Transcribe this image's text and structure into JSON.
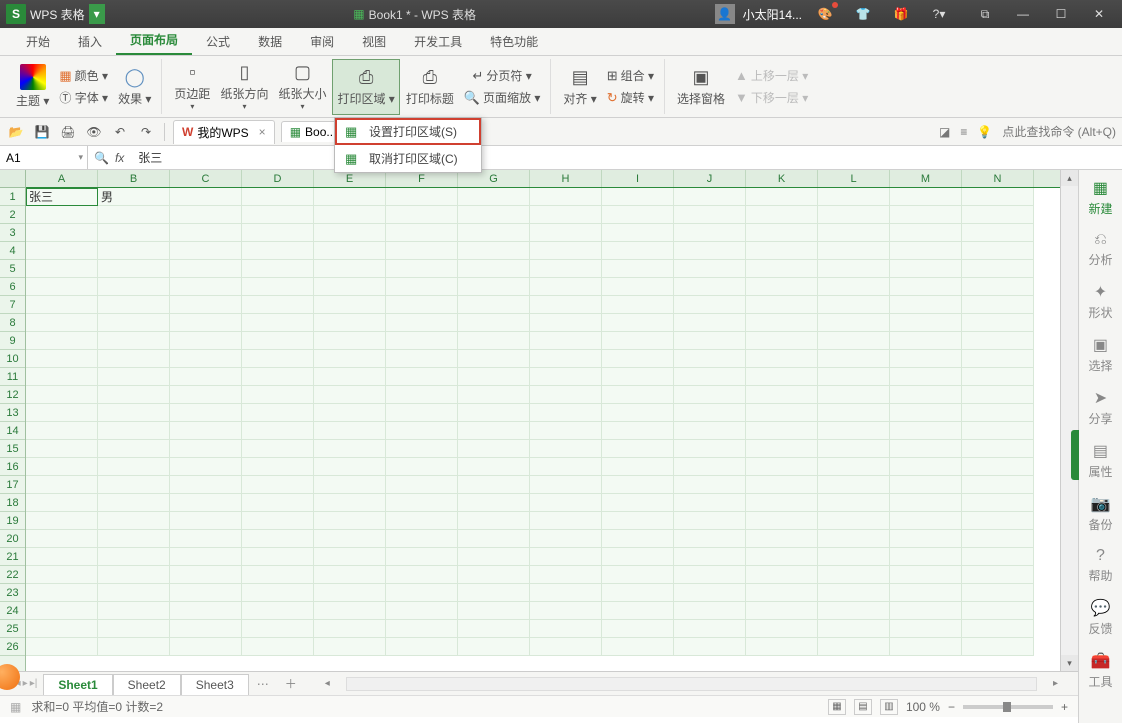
{
  "titlebar": {
    "app_badge": "S",
    "app_name": "WPS 表格",
    "doc_title": "Book1 * - WPS 表格",
    "user_name": "小太阳14..."
  },
  "menu": {
    "tabs": [
      "开始",
      "插入",
      "页面布局",
      "公式",
      "数据",
      "审阅",
      "视图",
      "开发工具",
      "特色功能"
    ],
    "active_index": 2
  },
  "ribbon": {
    "theme": "主题 ▾",
    "color": "颜色 ▾",
    "font": "Ⓣ 字体 ▾",
    "effect": "效果 ▾",
    "margins": "页边距",
    "orient": "纸张方向",
    "size": "纸张大小",
    "print_area": "打印区域 ▾",
    "print_title": "打印标题",
    "breaks": "分页符 ▾",
    "scale": "页面缩放 ▾",
    "align": "对齐 ▾",
    "group": "组合 ▾",
    "rotate": "旋转 ▾",
    "select_pane": "选择窗格",
    "up_layer": "上移一层 ▾",
    "down_layer": "下移一层 ▾"
  },
  "dropdown": {
    "set_area": "设置打印区域(S)",
    "cancel_area": "取消打印区域(C)"
  },
  "qat": {
    "my_wps": "我的WPS",
    "book_tab": "Boo...",
    "cmd_hint": "点此查找命令 (Alt+Q)"
  },
  "formula": {
    "cell_ref": "A1",
    "value": "张三"
  },
  "columns": [
    "A",
    "B",
    "C",
    "D",
    "E",
    "F",
    "G",
    "H",
    "I",
    "J",
    "K",
    "L",
    "M",
    "N"
  ],
  "cells": {
    "A1": "张三",
    "B1": "男"
  },
  "sheets": {
    "tabs": [
      "Sheet1",
      "Sheet2",
      "Sheet3"
    ],
    "active_index": 0
  },
  "side": {
    "new": "新建",
    "analyze": "分析",
    "shape": "形状",
    "select": "选择",
    "share": "分享",
    "prop": "属性",
    "backup": "备份",
    "help": "帮助",
    "feedback": "反馈",
    "tool": "工具"
  },
  "status": {
    "sum": "求和=0  平均值=0  计数=2",
    "zoom": "100 %"
  }
}
